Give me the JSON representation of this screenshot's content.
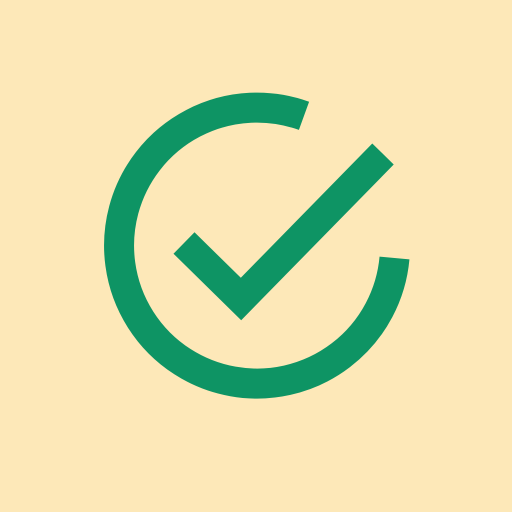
{
  "icon": {
    "name": "check-circle-icon",
    "background_color": "#FDE8B8",
    "stroke_color": "#0E9464"
  }
}
